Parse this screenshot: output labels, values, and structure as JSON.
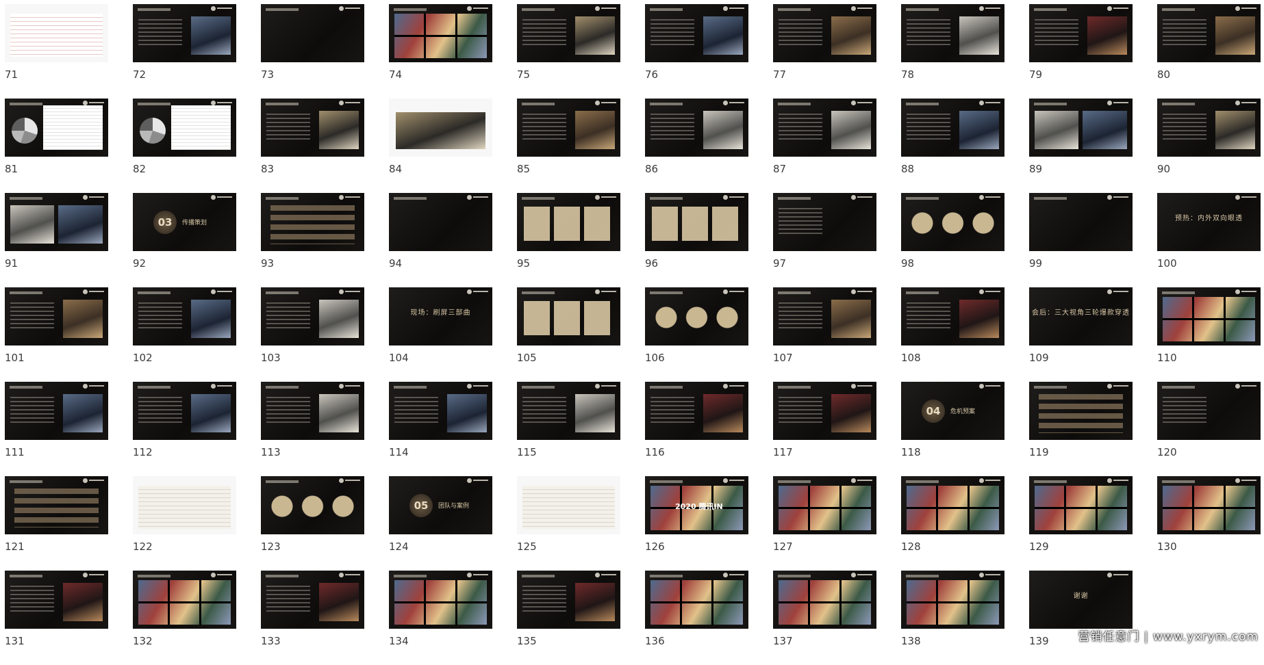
{
  "slides": [
    {
      "n": "71",
      "v": "table-red",
      "t": ""
    },
    {
      "n": "72",
      "v": "photo-b",
      "t": ""
    },
    {
      "n": "73",
      "v": "dark",
      "t": ""
    },
    {
      "n": "74",
      "v": "pics",
      "t": ""
    },
    {
      "n": "75",
      "v": "photo-c",
      "t": ""
    },
    {
      "n": "76",
      "v": "photo-b",
      "t": ""
    },
    {
      "n": "77",
      "v": "photo",
      "t": ""
    },
    {
      "n": "78",
      "v": "photo-e",
      "t": ""
    },
    {
      "n": "79",
      "v": "photo-d",
      "t": ""
    },
    {
      "n": "80",
      "v": "photo",
      "t": ""
    },
    {
      "n": "81",
      "v": "pie",
      "t": ""
    },
    {
      "n": "82",
      "v": "pie",
      "t": ""
    },
    {
      "n": "83",
      "v": "photo-c",
      "t": ""
    },
    {
      "n": "84",
      "v": "white-photo",
      "t": ""
    },
    {
      "n": "85",
      "v": "photo",
      "t": ""
    },
    {
      "n": "86",
      "v": "photo-e",
      "t": ""
    },
    {
      "n": "87",
      "v": "photo-e",
      "t": ""
    },
    {
      "n": "88",
      "v": "photo-b",
      "t": ""
    },
    {
      "n": "89",
      "v": "map",
      "t": ""
    },
    {
      "n": "90",
      "v": "photo-c",
      "t": ""
    },
    {
      "n": "91",
      "v": "map",
      "t": ""
    },
    {
      "n": "92",
      "v": "section",
      "t": "传播策划",
      "s": "03"
    },
    {
      "n": "93",
      "v": "bars",
      "t": ""
    },
    {
      "n": "94",
      "v": "dark",
      "t": ""
    },
    {
      "n": "95",
      "v": "cards",
      "t": ""
    },
    {
      "n": "96",
      "v": "cards",
      "t": ""
    },
    {
      "n": "97",
      "v": "lines",
      "t": ""
    },
    {
      "n": "98",
      "v": "circles",
      "t": ""
    },
    {
      "n": "99",
      "v": "dark",
      "t": ""
    },
    {
      "n": "100",
      "v": "text",
      "t": "预热：内外双向眼透"
    },
    {
      "n": "101",
      "v": "photo",
      "t": ""
    },
    {
      "n": "102",
      "v": "photo-b",
      "t": ""
    },
    {
      "n": "103",
      "v": "photo-e",
      "t": ""
    },
    {
      "n": "104",
      "v": "text",
      "t": "现场：刷屏三部曲"
    },
    {
      "n": "105",
      "v": "cards",
      "t": ""
    },
    {
      "n": "106",
      "v": "circles",
      "t": ""
    },
    {
      "n": "107",
      "v": "photo",
      "t": ""
    },
    {
      "n": "108",
      "v": "photo-d",
      "t": ""
    },
    {
      "n": "109",
      "v": "text",
      "t": "会后：三大视角三轮爆款穿透"
    },
    {
      "n": "110",
      "v": "pics",
      "t": ""
    },
    {
      "n": "111",
      "v": "photo-b",
      "t": ""
    },
    {
      "n": "112",
      "v": "photo-b",
      "t": ""
    },
    {
      "n": "113",
      "v": "photo-e",
      "t": ""
    },
    {
      "n": "114",
      "v": "photo-b",
      "t": ""
    },
    {
      "n": "115",
      "v": "photo-e",
      "t": ""
    },
    {
      "n": "116",
      "v": "photo-d",
      "t": ""
    },
    {
      "n": "117",
      "v": "photo-d",
      "t": ""
    },
    {
      "n": "118",
      "v": "section",
      "t": "危机预案",
      "s": "04"
    },
    {
      "n": "119",
      "v": "bars",
      "t": ""
    },
    {
      "n": "120",
      "v": "lines",
      "t": ""
    },
    {
      "n": "121",
      "v": "bars",
      "t": ""
    },
    {
      "n": "122",
      "v": "table",
      "t": ""
    },
    {
      "n": "123",
      "v": "circles",
      "t": ""
    },
    {
      "n": "124",
      "v": "section",
      "t": "团队与案例",
      "s": "05"
    },
    {
      "n": "125",
      "v": "table",
      "t": ""
    },
    {
      "n": "126",
      "v": "pics",
      "t": "2020 腾讯IN"
    },
    {
      "n": "127",
      "v": "pics",
      "t": ""
    },
    {
      "n": "128",
      "v": "pics",
      "t": ""
    },
    {
      "n": "129",
      "v": "pics",
      "t": ""
    },
    {
      "n": "130",
      "v": "pics",
      "t": ""
    },
    {
      "n": "131",
      "v": "photo-d",
      "t": ""
    },
    {
      "n": "132",
      "v": "pics",
      "t": ""
    },
    {
      "n": "133",
      "v": "photo-d",
      "t": ""
    },
    {
      "n": "134",
      "v": "pics",
      "t": ""
    },
    {
      "n": "135",
      "v": "photo-d",
      "t": ""
    },
    {
      "n": "136",
      "v": "pics",
      "t": ""
    },
    {
      "n": "137",
      "v": "pics",
      "t": ""
    },
    {
      "n": "138",
      "v": "pics",
      "t": ""
    },
    {
      "n": "139",
      "v": "text",
      "t": "谢谢"
    }
  ],
  "watermark": "营销任意门 | www.yxrym.com"
}
